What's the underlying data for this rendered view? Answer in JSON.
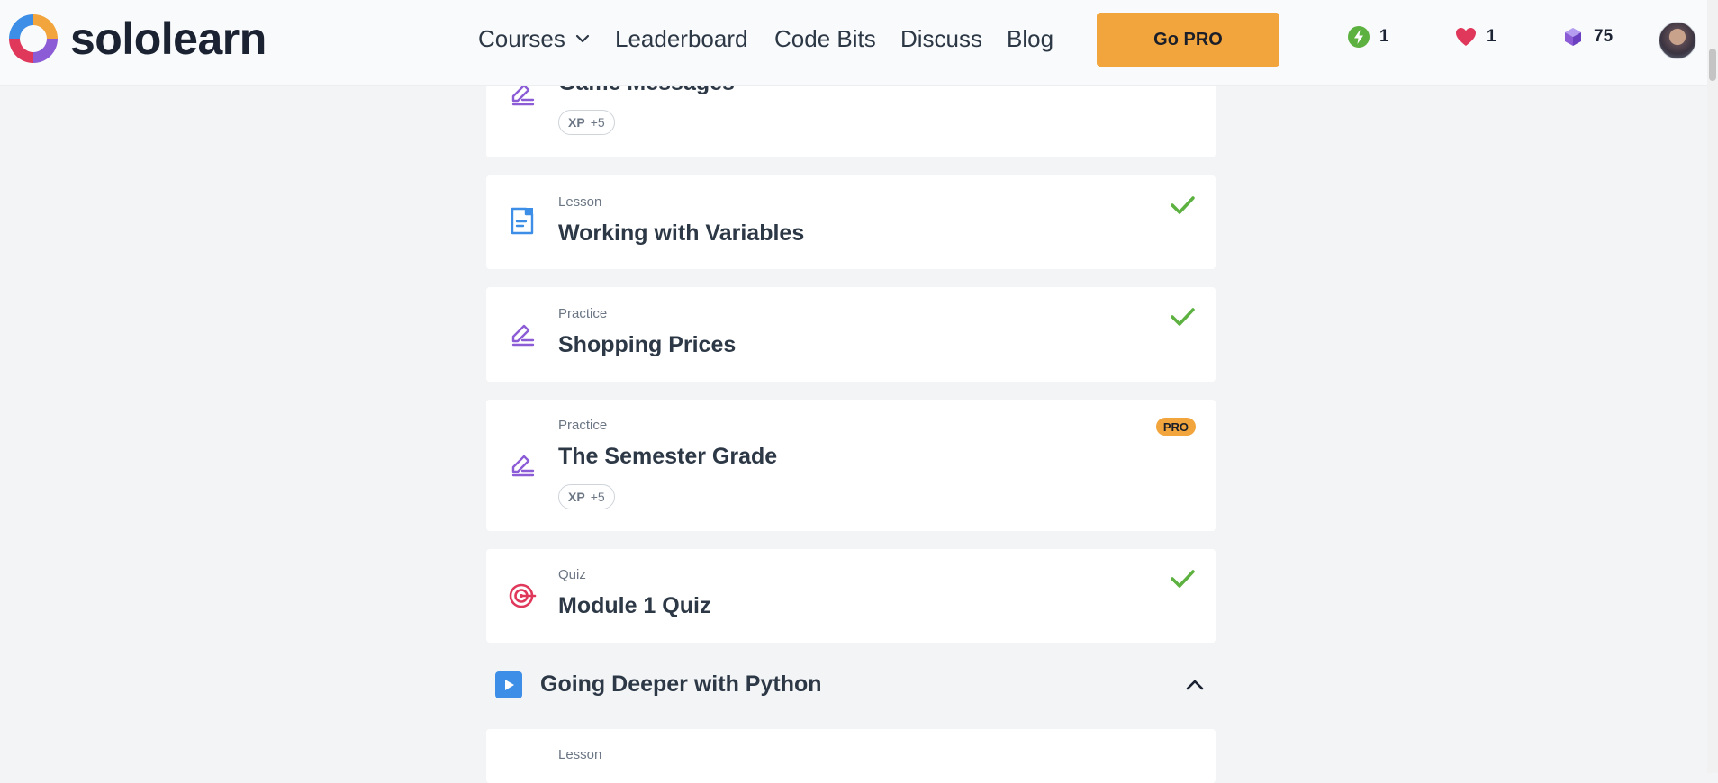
{
  "brand": {
    "name": "sololearn"
  },
  "nav": {
    "courses": "Courses",
    "leaderboard": "Leaderboard",
    "code_bits": "Code Bits",
    "discuss": "Discuss",
    "blog": "Blog"
  },
  "go_pro": "Go PRO",
  "stats": {
    "streak": "1",
    "hearts": "1",
    "gems": "75"
  },
  "items": [
    {
      "type": "",
      "title": "Game Messages",
      "xp_label": "XP",
      "xp_value": "+5",
      "icon": "practice-pencil-icon"
    },
    {
      "type": "Lesson",
      "title": "Working with Variables",
      "icon": "lesson-document-icon",
      "completed": true
    },
    {
      "type": "Practice",
      "title": "Shopping Prices",
      "icon": "practice-pencil-icon",
      "completed": true
    },
    {
      "type": "Practice",
      "title": "The Semester Grade",
      "badge": "PRO",
      "xp_label": "XP",
      "xp_value": "+5",
      "icon": "practice-pencil-icon"
    },
    {
      "type": "Quiz",
      "title": "Module 1 Quiz",
      "icon": "quiz-target-icon",
      "completed": true
    },
    {
      "type": "Lesson",
      "title": "",
      "icon": "lesson-document-icon"
    }
  ],
  "section": {
    "title": "Going Deeper with Python",
    "icon": "play-icon",
    "expanded": true
  },
  "colors": {
    "accent": "#f1a53c",
    "check": "#5db140",
    "practice": "#8b5cd6",
    "lesson": "#3d8ee6",
    "quiz": "#e0385b"
  }
}
